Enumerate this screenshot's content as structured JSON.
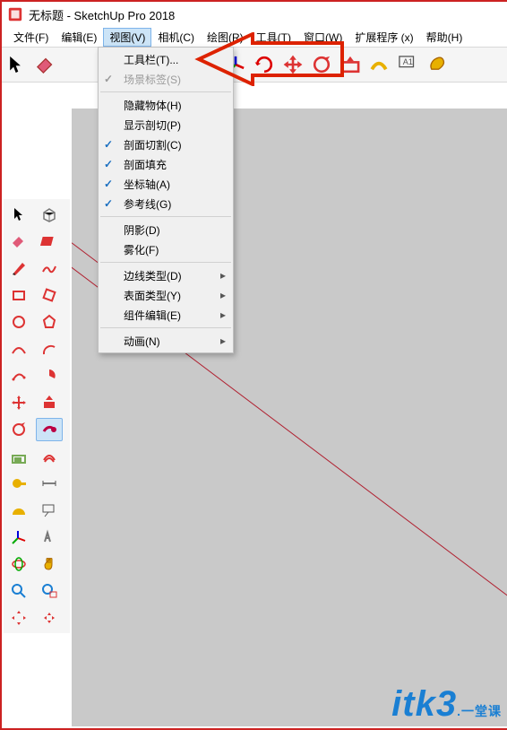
{
  "title": "无标题 - SketchUp Pro 2018",
  "menubar": [
    {
      "label": "文件(F)"
    },
    {
      "label": "编辑(E)"
    },
    {
      "label": "视图(V)",
      "active": true
    },
    {
      "label": "相机(C)"
    },
    {
      "label": "绘图(R)"
    },
    {
      "label": "工具(T)"
    },
    {
      "label": "窗口(W)"
    },
    {
      "label": "扩展程序 (x)"
    },
    {
      "label": "帮助(H)"
    }
  ],
  "dropdown": {
    "items": [
      {
        "label": "工具栏(T)..."
      },
      {
        "label": "场景标签(S)",
        "disabled": true,
        "checked": true,
        "greycheck": true
      },
      {
        "sep": true
      },
      {
        "label": "隐藏物体(H)"
      },
      {
        "label": "显示剖切(P)"
      },
      {
        "label": "剖面切割(C)",
        "checked": true
      },
      {
        "label": "剖面填充",
        "checked": true
      },
      {
        "label": "坐标轴(A)",
        "checked": true
      },
      {
        "label": "参考线(G)",
        "checked": true
      },
      {
        "sep": true
      },
      {
        "label": "阴影(D)"
      },
      {
        "label": "雾化(F)"
      },
      {
        "sep": true
      },
      {
        "label": "边线类型(D)",
        "submenu": true
      },
      {
        "label": "表面类型(Y)",
        "submenu": true
      },
      {
        "label": "组件编辑(E)",
        "submenu": true
      },
      {
        "sep": true
      },
      {
        "label": "动画(N)",
        "submenu": true
      }
    ]
  },
  "watermark": {
    "main": "itk3",
    "sub": ".一堂课"
  }
}
